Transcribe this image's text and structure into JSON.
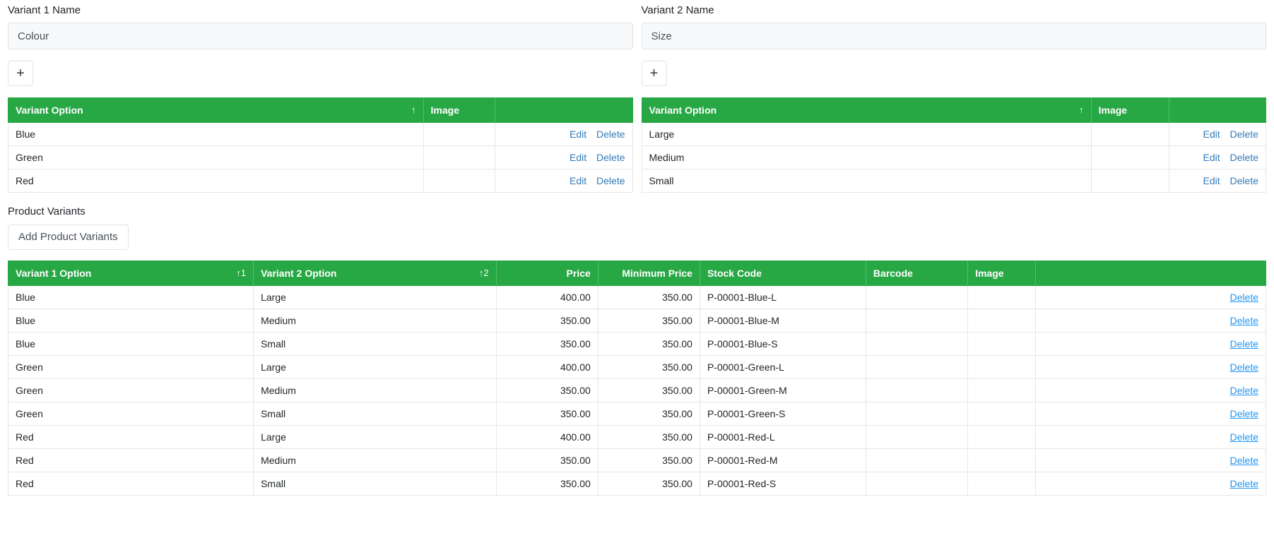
{
  "variant_panels": [
    {
      "label": "Variant 1 Name",
      "input_value": "Colour",
      "input_placeholder": "Colour",
      "add_button_label": "+",
      "table": {
        "columns": [
          "Variant Option",
          "Image",
          ""
        ],
        "sort_indicator": "↑",
        "rows": [
          {
            "option": "Blue",
            "image": "",
            "edit_label": "Edit",
            "delete_label": "Delete"
          },
          {
            "option": "Green",
            "image": "",
            "edit_label": "Edit",
            "delete_label": "Delete"
          },
          {
            "option": "Red",
            "image": "",
            "edit_label": "Edit",
            "delete_label": "Delete"
          }
        ]
      }
    },
    {
      "label": "Variant 2 Name",
      "input_value": "Size",
      "input_placeholder": "Size",
      "add_button_label": "+",
      "table": {
        "columns": [
          "Variant Option",
          "Image",
          ""
        ],
        "sort_indicator": "↑",
        "rows": [
          {
            "option": "Large",
            "image": "",
            "edit_label": "Edit",
            "delete_label": "Delete"
          },
          {
            "option": "Medium",
            "image": "",
            "edit_label": "Edit",
            "delete_label": "Delete"
          },
          {
            "option": "Small",
            "image": "",
            "edit_label": "Edit",
            "delete_label": "Delete"
          }
        ]
      }
    }
  ],
  "product_variants": {
    "label": "Product Variants",
    "add_button_label": "Add Product Variants",
    "columns": [
      "Variant 1 Option",
      "Variant 2 Option",
      "Price",
      "Minimum Price",
      "Stock Code",
      "Barcode",
      "Image",
      ""
    ],
    "sort_indicator_1": "↑1",
    "sort_indicator_2": "↑2",
    "delete_label": "Delete",
    "rows": [
      {
        "variant1": "Blue",
        "variant2": "Large",
        "price": "400.00",
        "min_price": "350.00",
        "stock_code": "P-00001-Blue-L",
        "barcode": "",
        "image": ""
      },
      {
        "variant1": "Blue",
        "variant2": "Medium",
        "price": "350.00",
        "min_price": "350.00",
        "stock_code": "P-00001-Blue-M",
        "barcode": "",
        "image": ""
      },
      {
        "variant1": "Blue",
        "variant2": "Small",
        "price": "350.00",
        "min_price": "350.00",
        "stock_code": "P-00001-Blue-S",
        "barcode": "",
        "image": ""
      },
      {
        "variant1": "Green",
        "variant2": "Large",
        "price": "400.00",
        "min_price": "350.00",
        "stock_code": "P-00001-Green-L",
        "barcode": "",
        "image": ""
      },
      {
        "variant1": "Green",
        "variant2": "Medium",
        "price": "350.00",
        "min_price": "350.00",
        "stock_code": "P-00001-Green-M",
        "barcode": "",
        "image": ""
      },
      {
        "variant1": "Green",
        "variant2": "Small",
        "price": "350.00",
        "min_price": "350.00",
        "stock_code": "P-00001-Green-S",
        "barcode": "",
        "image": ""
      },
      {
        "variant1": "Red",
        "variant2": "Large",
        "price": "400.00",
        "min_price": "350.00",
        "stock_code": "P-00001-Red-L",
        "barcode": "",
        "image": ""
      },
      {
        "variant1": "Red",
        "variant2": "Medium",
        "price": "350.00",
        "min_price": "350.00",
        "stock_code": "P-00001-Red-M",
        "barcode": "",
        "image": ""
      },
      {
        "variant1": "Red",
        "variant2": "Small",
        "price": "350.00",
        "min_price": "350.00",
        "stock_code": "P-00001-Red-S",
        "barcode": "",
        "image": ""
      }
    ]
  },
  "colors": {
    "header_green": "#28a745",
    "link_blue": "#337ab7",
    "delete_blue": "#2196f3",
    "input_bg": "#f8f9fa",
    "border": "#dee2e6"
  }
}
